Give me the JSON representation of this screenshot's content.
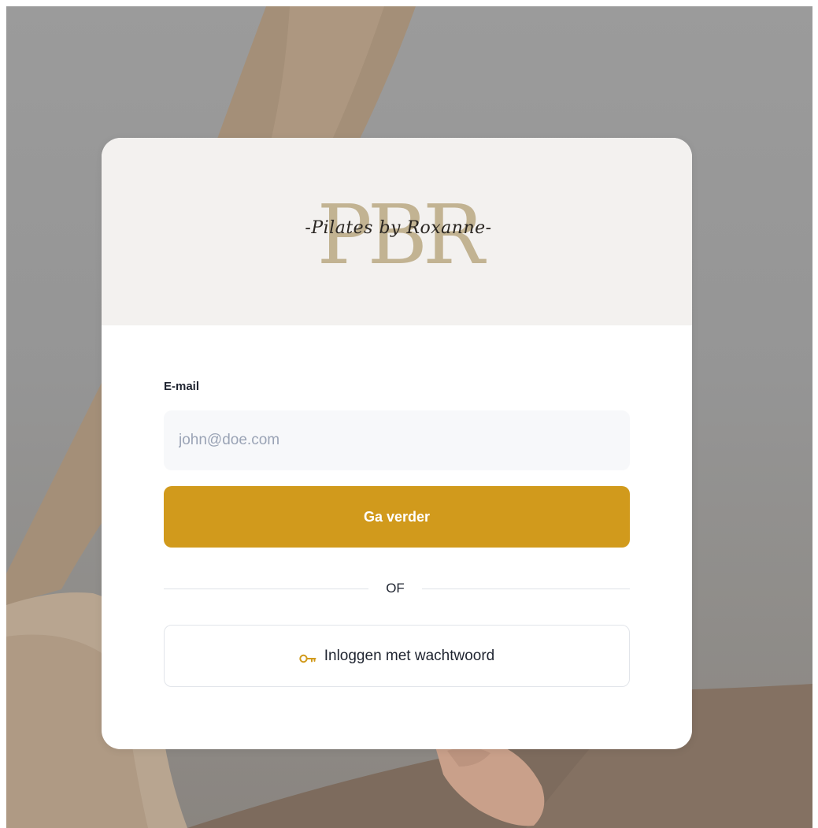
{
  "brand": {
    "monogram": "PBR",
    "script": "-Pilates by Roxanne-",
    "monogram_color": "#c2b392"
  },
  "form": {
    "email_label": "E-mail",
    "email_placeholder": "john@doe.com",
    "email_value": "",
    "continue_label": "Ga verder",
    "divider_text": "OF",
    "password_login_label": "Inloggen met wachtwoord",
    "password_login_icon": "key-icon"
  },
  "colors": {
    "accent": "#d19a1c",
    "header_bg": "#f3f1ef",
    "input_bg": "#f7f8fa"
  }
}
